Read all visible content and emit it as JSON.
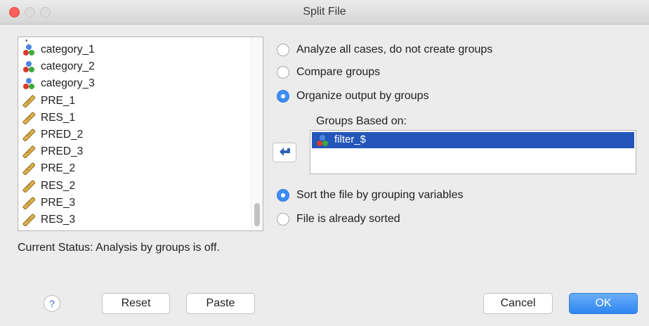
{
  "window": {
    "title": "Split File"
  },
  "variables": [
    {
      "name": "category_1",
      "icon": "nominal-icon"
    },
    {
      "name": "category_2",
      "icon": "nominal-icon"
    },
    {
      "name": "category_3",
      "icon": "nominal-icon"
    },
    {
      "name": "PRE_1",
      "icon": "scale-icon"
    },
    {
      "name": "RES_1",
      "icon": "scale-icon"
    },
    {
      "name": "PRED_2",
      "icon": "scale-icon"
    },
    {
      "name": "PRED_3",
      "icon": "scale-icon"
    },
    {
      "name": "PRE_2",
      "icon": "scale-icon"
    },
    {
      "name": "RES_2",
      "icon": "scale-icon"
    },
    {
      "name": "PRE_3",
      "icon": "scale-icon"
    },
    {
      "name": "RES_3",
      "icon": "scale-icon"
    }
  ],
  "status": "Current Status: Analysis by groups is off.",
  "options": {
    "analyze_all": "Analyze all cases, do not create groups",
    "compare": "Compare groups",
    "organize": "Organize output by groups",
    "selected": "organize"
  },
  "groups": {
    "label": "Groups Based on:",
    "items": [
      {
        "name": "filter_$",
        "icon": "nominal-icon"
      }
    ]
  },
  "sort": {
    "sort_label": "Sort the file by grouping variables",
    "sorted_label": "File is already sorted",
    "selected": "sort"
  },
  "buttons": {
    "help": "?",
    "reset": "Reset",
    "paste": "Paste",
    "cancel": "Cancel",
    "ok": "OK"
  },
  "colors": {
    "accent": "#3d8ef5",
    "selection": "#2356b8",
    "close": "#fc605c"
  }
}
